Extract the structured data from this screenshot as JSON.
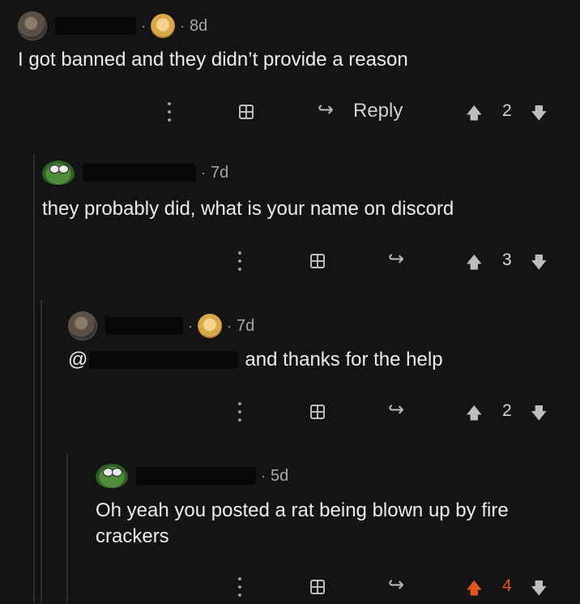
{
  "comments": [
    {
      "age": "8d",
      "text": "I got banned and they didn’t provide a reason",
      "reply_label": "Reply",
      "score": "2",
      "score_active": false,
      "icons": [
        "avatar-photo",
        "award-doge"
      ]
    },
    {
      "age": "7d",
      "text": "they probably did, what is your name on discord",
      "reply_label": "",
      "score": "3",
      "score_active": false,
      "icons": [
        "avatar-pepe"
      ]
    },
    {
      "age": "7d",
      "mention": "@",
      "text": "and thanks for the help",
      "reply_label": "",
      "score": "2",
      "score_active": false,
      "icons": [
        "avatar-photo",
        "award-doge"
      ]
    },
    {
      "age": "5d",
      "text": "Oh yeah you posted a rat being blown up by fire crackers",
      "reply_label": "",
      "score": "4",
      "score_active": true,
      "icons": [
        "avatar-pepe"
      ]
    }
  ],
  "colors": {
    "background": "#141414",
    "text": "#ececec",
    "muted": "#a9a9a9",
    "upvote_active": "#e2551f"
  },
  "icon_names": [
    "more-options-icon",
    "gift-icon",
    "reply-icon",
    "upvote-icon",
    "downvote-icon"
  ]
}
